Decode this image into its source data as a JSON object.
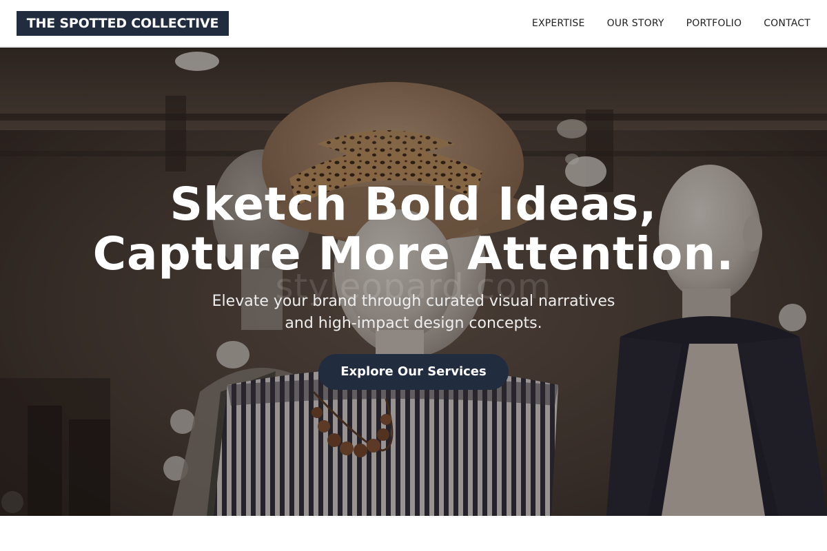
{
  "header": {
    "logo_text": "THE SPOTTED COLLECTIVE",
    "nav": [
      {
        "label": "EXPERTISE"
      },
      {
        "label": "OUR STORY"
      },
      {
        "label": "PORTFOLIO"
      },
      {
        "label": "CONTACT"
      }
    ]
  },
  "hero": {
    "title_line1": "Sketch Bold Ideas,",
    "title_line2": "Capture More Attention.",
    "subtitle_line1": "Elevate your brand through curated visual narratives",
    "subtitle_line2": "and high-impact design concepts.",
    "cta_label": "Explore Our Services",
    "watermark": "styleopard.com",
    "photo": "boutique mannequins wearing a straw hat with leopard-print scarf, striped off-shoulder top, bead necklace and dark blazer"
  },
  "colors": {
    "brand_navy": "#212c3f",
    "header_bg": "#ffffff",
    "hero_text": "#ffffff"
  }
}
